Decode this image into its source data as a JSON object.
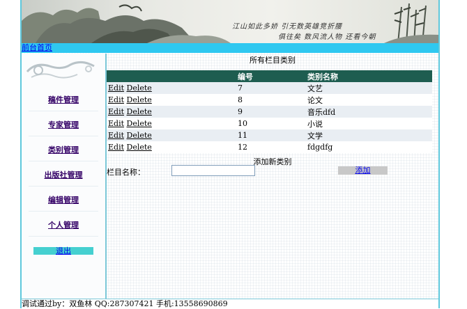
{
  "banner": {
    "poem_line1": "江山如此多娇 引无数英雄竞折腰",
    "poem_line2": "俱往矣 数风流人物 还看今朝"
  },
  "topbar": {
    "home_link": "前台首页"
  },
  "sidebar": {
    "items": [
      {
        "label": "稿件管理"
      },
      {
        "label": "专家管理"
      },
      {
        "label": "类别管理"
      },
      {
        "label": "出版社管理"
      },
      {
        "label": "编辑管理"
      },
      {
        "label": "个人管理"
      }
    ],
    "logout_label": "退出"
  },
  "main": {
    "caption": "所有栏目类别",
    "columns": [
      "",
      "编号",
      "类别名称"
    ],
    "edit_label": "Edit",
    "delete_label": "Delete",
    "rows": [
      {
        "id": "7",
        "name": "文艺"
      },
      {
        "id": "8",
        "name": "论文"
      },
      {
        "id": "9",
        "name": "音乐dfd"
      },
      {
        "id": "10",
        "name": "小说"
      },
      {
        "id": "11",
        "name": "文学"
      },
      {
        "id": "12",
        "name": "fdgdfg"
      }
    ],
    "add_title": "添加新类别",
    "name_label": "栏目名称：",
    "name_value": "",
    "add_button": "添加"
  },
  "footer": {
    "text": "调试通过by：双鱼林 QQ:287307421 手机:13558690869"
  },
  "colors": {
    "topbar": "#2fc8f0",
    "table_header": "#1e5d50",
    "row_stripe": "#e9eef3",
    "logout_bg": "#45d0d0",
    "frame_border": "#5fc8dc"
  }
}
